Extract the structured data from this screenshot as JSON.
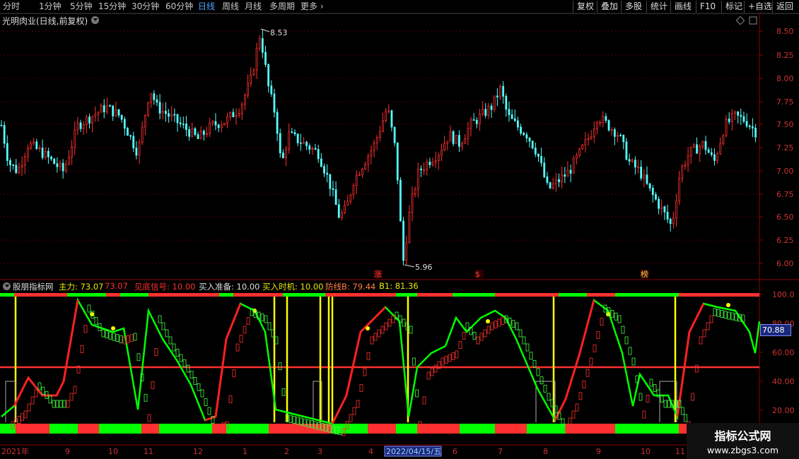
{
  "toolbar": {
    "periods": [
      "分时",
      "1分钟",
      "5分钟",
      "15分钟",
      "30分钟",
      "60分钟",
      "日线",
      "周线",
      "月线",
      "多周期",
      "更多"
    ],
    "active": "日线",
    "right": [
      "复权",
      "叠加",
      "多股",
      "统计",
      "画线",
      "F10",
      "标记",
      "+自选",
      "返回"
    ]
  },
  "chart": {
    "stock_title": "光明肉业(日线,前复权)",
    "high_label": "8.53",
    "low_label": "5.96",
    "markers": [
      "涨",
      "$",
      "榜"
    ],
    "price_axis": [
      "8.50",
      "8.25",
      "8.00",
      "7.75",
      "7.50",
      "7.25",
      "7.00",
      "6.75",
      "6.50",
      "6.25",
      "6.00"
    ]
  },
  "indicator": {
    "name": "股朋指标网",
    "items": [
      {
        "label": "主力:",
        "value": "73.07",
        "color": "#e8e800"
      },
      {
        "label": "",
        "value": "73.07",
        "color": "#ff3030"
      },
      {
        "label": "见底信号:",
        "value": "10.00",
        "color": "#ff3030"
      },
      {
        "label": "买入准备:",
        "value": "10.00",
        "color": "#dddddd"
      },
      {
        "label": "买入时机:",
        "value": "10.00",
        "color": "#e8e800"
      },
      {
        "label": "防线B:",
        "value": "79.44",
        "color": "#ff8040"
      },
      {
        "label": "B1:",
        "value": "81.36",
        "color": "#e8e800"
      }
    ],
    "axis": [
      "100.0",
      "80.00",
      "60.00",
      "40.00",
      "20.00"
    ],
    "current": "70.88"
  },
  "dates": [
    "2021年",
    "9",
    "10",
    "11",
    "12",
    "1",
    "2",
    "3",
    "4",
    "2022/04/15/五",
    "6",
    "7",
    "8",
    "9",
    "10",
    "11"
  ],
  "watermark": {
    "line1": "指标公式网",
    "line2": "www.zbgs3.com"
  },
  "colors": {
    "up": "#ff3030",
    "down": "#54ffff",
    "green": "#00ff00",
    "yellow": "#ffff00",
    "grid": "#8b0000"
  }
}
